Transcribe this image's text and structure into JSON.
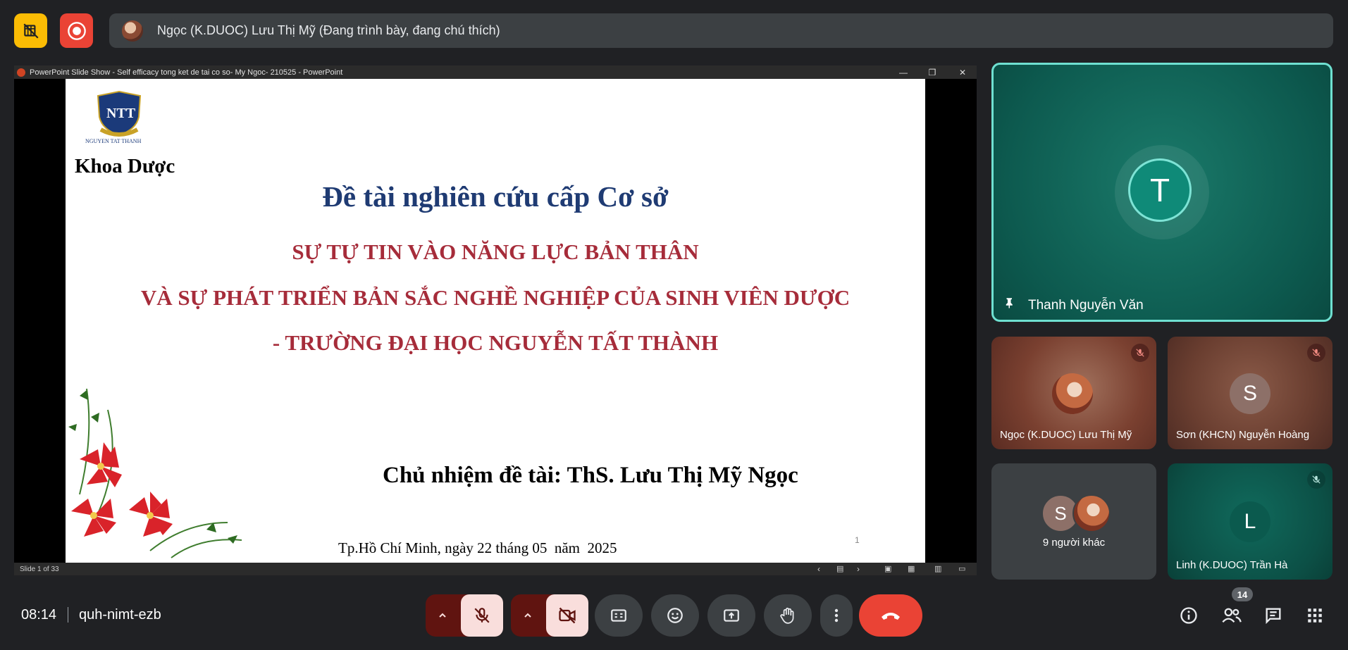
{
  "presenter": {
    "label": "Ngọc (K.DUOC) Lưu Thị Mỹ (Đang trình bày, đang chú thích)"
  },
  "ppt": {
    "window_title": "PowerPoint Slide Show  -  Self efficacy tong ket de tai co so- My Ngoc- 210525 - PowerPoint",
    "status": "Slide 1 of 33",
    "slide": {
      "logo_text": "NTT",
      "logo_caption": "NGUYEN TAT THANH",
      "faculty": "Khoa Dược",
      "heading": "Đề tài nghiên cứu cấp Cơ sở",
      "title_line1": "SỰ TỰ TIN VÀO NĂNG LỰC BẢN THÂN",
      "title_line2": "VÀ SỰ PHÁT TRIỂN BẢN SẮC NGHỀ NGHIỆP CỦA SINH VIÊN DƯỢC",
      "title_line3": "- TRƯỜNG ĐẠI HỌC NGUYỄN TẤT THÀNH",
      "lead": "Chủ nhiệm đề tài: ThS. Lưu Thị Mỹ Ngọc",
      "place_date": "Tp.Hồ Chí Minh, ngày 22 tháng 05  năm  2025",
      "page_number": "1"
    }
  },
  "participants": {
    "pinned": {
      "initial": "T",
      "name": "Thanh Nguyễn Văn"
    },
    "tile2": {
      "name": "Ngọc (K.DUOC) Lưu Thị Mỹ"
    },
    "tile3": {
      "initial": "S",
      "name": "Sơn (KHCN) Nguyễn Hoàng"
    },
    "tile4": {
      "initial": "S",
      "label": "9 người khác"
    },
    "tile5": {
      "initial": "L",
      "name": "Linh (K.DUOC) Trần Hà"
    }
  },
  "meeting": {
    "time": "08:14",
    "code": "quh-nimt-ezb",
    "participant_count": "14"
  },
  "colors": {
    "accent_yellow": "#fbbc04",
    "record_red": "#ea4335",
    "danger_pink": "#f9dedc",
    "danger_dark": "#601410",
    "teal": "#0f6e60",
    "pin_border": "#6fe0d1"
  }
}
